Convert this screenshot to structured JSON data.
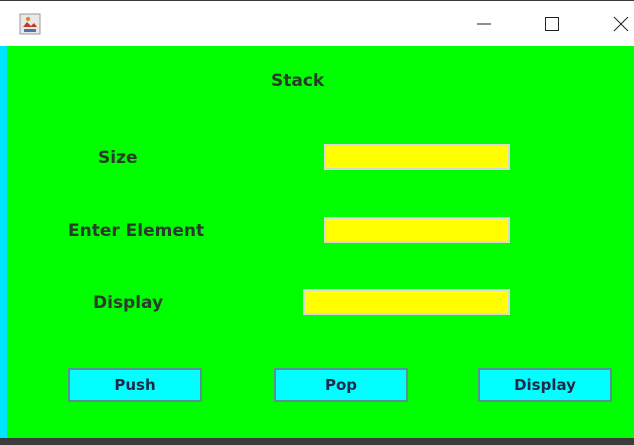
{
  "window": {
    "icons": {
      "app": "java-cup-icon",
      "minimize": "minimize-icon",
      "maximize": "maximize-icon",
      "close": "close-icon"
    }
  },
  "form": {
    "title": "Stack",
    "size_label": "Size",
    "size_value": "",
    "element_label": "Enter Element",
    "element_value": "",
    "display_label": "Display",
    "display_value": ""
  },
  "buttons": {
    "push": "Push",
    "pop": "Pop",
    "display": "Display"
  },
  "colors": {
    "background": "#00ff00",
    "field": "#ffff00",
    "button": "#00ffff"
  }
}
